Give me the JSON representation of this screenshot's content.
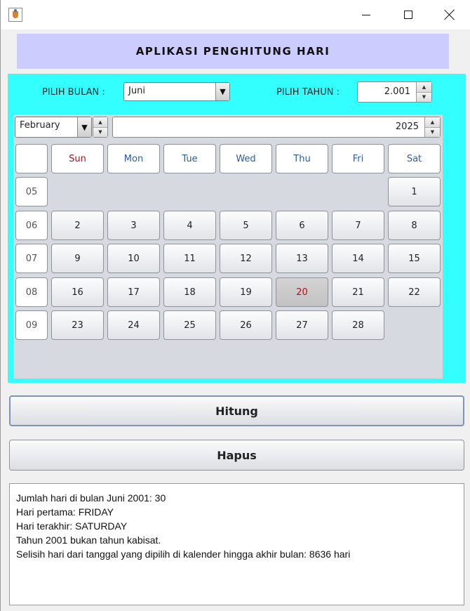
{
  "window": {
    "controls": [
      "minimize-icon",
      "maximize-icon",
      "close-icon"
    ]
  },
  "header": {
    "title": "APLIKASI PENGHITUNG HARI",
    "bg_color": "#ccccff"
  },
  "panel": {
    "bg_color": "#33ffff"
  },
  "form": {
    "bulan_label": "PILIH BULAN :",
    "bulan_value": "Juni",
    "tahun_label": "PILIH TAHUN :",
    "tahun_value": "2.001"
  },
  "calendar": {
    "month": "February",
    "year": "2025",
    "days_of_week": [
      "Sun",
      "Mon",
      "Tue",
      "Wed",
      "Thu",
      "Fri",
      "Sat"
    ],
    "weeks": [
      {
        "num": "05",
        "days": [
          "",
          "",
          "",
          "",
          "",
          "",
          "1"
        ]
      },
      {
        "num": "06",
        "days": [
          "2",
          "3",
          "4",
          "5",
          "6",
          "7",
          "8"
        ]
      },
      {
        "num": "07",
        "days": [
          "9",
          "10",
          "11",
          "12",
          "13",
          "14",
          "15"
        ]
      },
      {
        "num": "08",
        "days": [
          "16",
          "17",
          "18",
          "19",
          "20",
          "21",
          "22"
        ]
      },
      {
        "num": "09",
        "days": [
          "23",
          "24",
          "25",
          "26",
          "27",
          "28",
          ""
        ]
      }
    ],
    "selected_day": "20",
    "today_color": "#b0101a",
    "sunday_color": "#a0141e",
    "weekday_color": "#2a5d9f"
  },
  "buttons": {
    "hitung": "Hitung",
    "hapus": "Hapus"
  },
  "output": {
    "lines": [
      "Jumlah hari di bulan Juni 2001: 30",
      "Hari pertama: FRIDAY",
      "Hari terakhir: SATURDAY",
      "Tahun 2001 bukan tahun kabisat.",
      "Selisih hari dari tanggal yang dipilih di kalender hingga akhir bulan: 8636 hari"
    ]
  }
}
